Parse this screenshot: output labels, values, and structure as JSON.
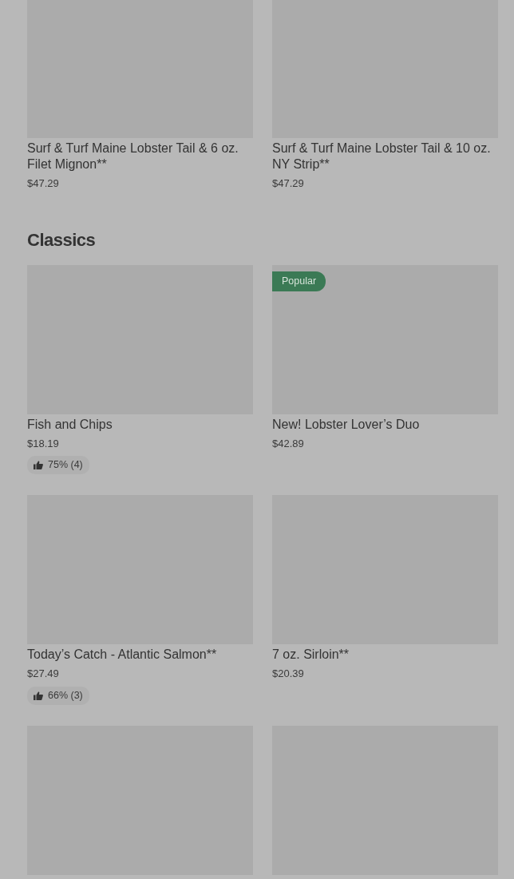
{
  "sections": [
    {
      "rows": [
        [
          {
            "kind": "dish",
            "name": "Surf & Turf Maine Lobster Tail & 6 oz. Filet Mignon**",
            "price": "$47.29"
          },
          {
            "kind": "dish",
            "name": "Surf & Turf Maine Lobster Tail & 10 oz. NY Strip**",
            "price": "$47.29"
          }
        ]
      ]
    },
    {
      "title": "Classics",
      "rows": [
        [
          {
            "kind": "dish",
            "name": "Fish and Chips",
            "price": "$18.19",
            "rating": "75% (4)"
          },
          {
            "kind": "dish",
            "badge": "Popular",
            "name": "New! Lobster Lover’s Duo",
            "price": "$42.89"
          }
        ],
        [
          {
            "kind": "dish",
            "name": "Today’s Catch - Atlantic Salmon**",
            "price": "$27.49",
            "rating": "66% (3)"
          },
          {
            "kind": "dish",
            "name": "7 oz. Sirloin**",
            "price": "$20.39"
          }
        ],
        [
          {
            "kind": "placeholder"
          },
          {
            "kind": "placeholder"
          }
        ]
      ]
    }
  ]
}
